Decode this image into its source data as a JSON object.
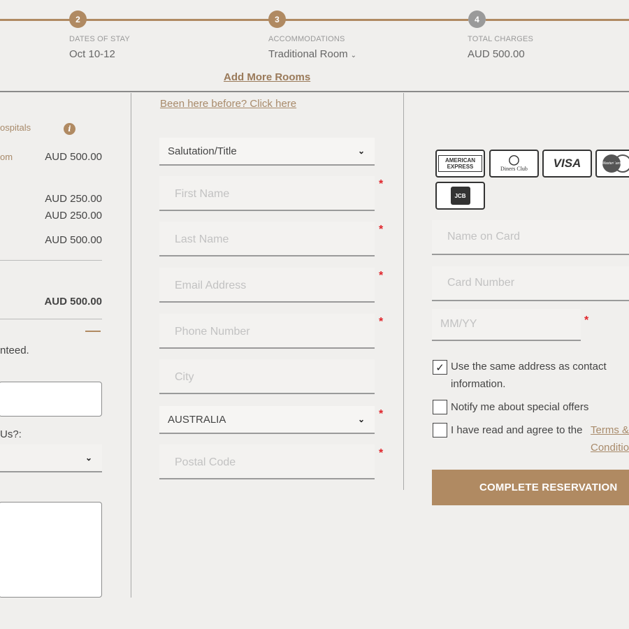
{
  "steps": [
    {
      "number": "2",
      "label": "DATES OF STAY",
      "value": "Oct 10-12"
    },
    {
      "number": "3",
      "label": "ACCOMMODATIONS",
      "value": "Traditional Room"
    },
    {
      "number": "4",
      "label": "TOTAL CHARGES",
      "value": "AUD 500.00"
    }
  ],
  "add_more_rooms": "Add More Rooms",
  "summary": {
    "row1_label": "ospitals",
    "row2_label": "om",
    "row2_amount": "AUD 500.00",
    "nightly_1": "AUD 250.00",
    "nightly_2": "AUD 250.00",
    "subtotal": "AUD 500.00",
    "total": "AUD 500.00",
    "guarantee_text": "nteed.",
    "how_heard_label": "Us?:"
  },
  "form": {
    "returning_link": "Been here before? Click here",
    "salutation": "Salutation/Title",
    "first_name_placeholder": "First Name",
    "last_name_placeholder": "Last Name",
    "email_placeholder": "Email Address",
    "phone_placeholder": "Phone Number",
    "city_placeholder": "City",
    "country": "AUSTRALIA",
    "postal_placeholder": "Postal Code",
    "required_mark": "*"
  },
  "payment": {
    "cards": [
      "AMERICAN EXPRESS",
      "Diners Club",
      "VISA",
      "MasterCard",
      "JCB"
    ],
    "name_on_card_placeholder": "Name on Card",
    "card_number_placeholder": "Card Number",
    "expiry_placeholder": "MM/YY",
    "same_address_label": "Use the same address as contact information.",
    "notify_label": "Notify me about special offers",
    "terms_prefix": "I have read and agree to the ",
    "terms_link": "Terms & Conditions",
    "complete_button": "COMPLETE RESERVATION",
    "same_address_checked": true,
    "notify_checked": false,
    "terms_checked": false
  },
  "colors": {
    "accent": "#b08a62",
    "required": "#e0242a",
    "inactive_step": "#9a9a9a"
  }
}
